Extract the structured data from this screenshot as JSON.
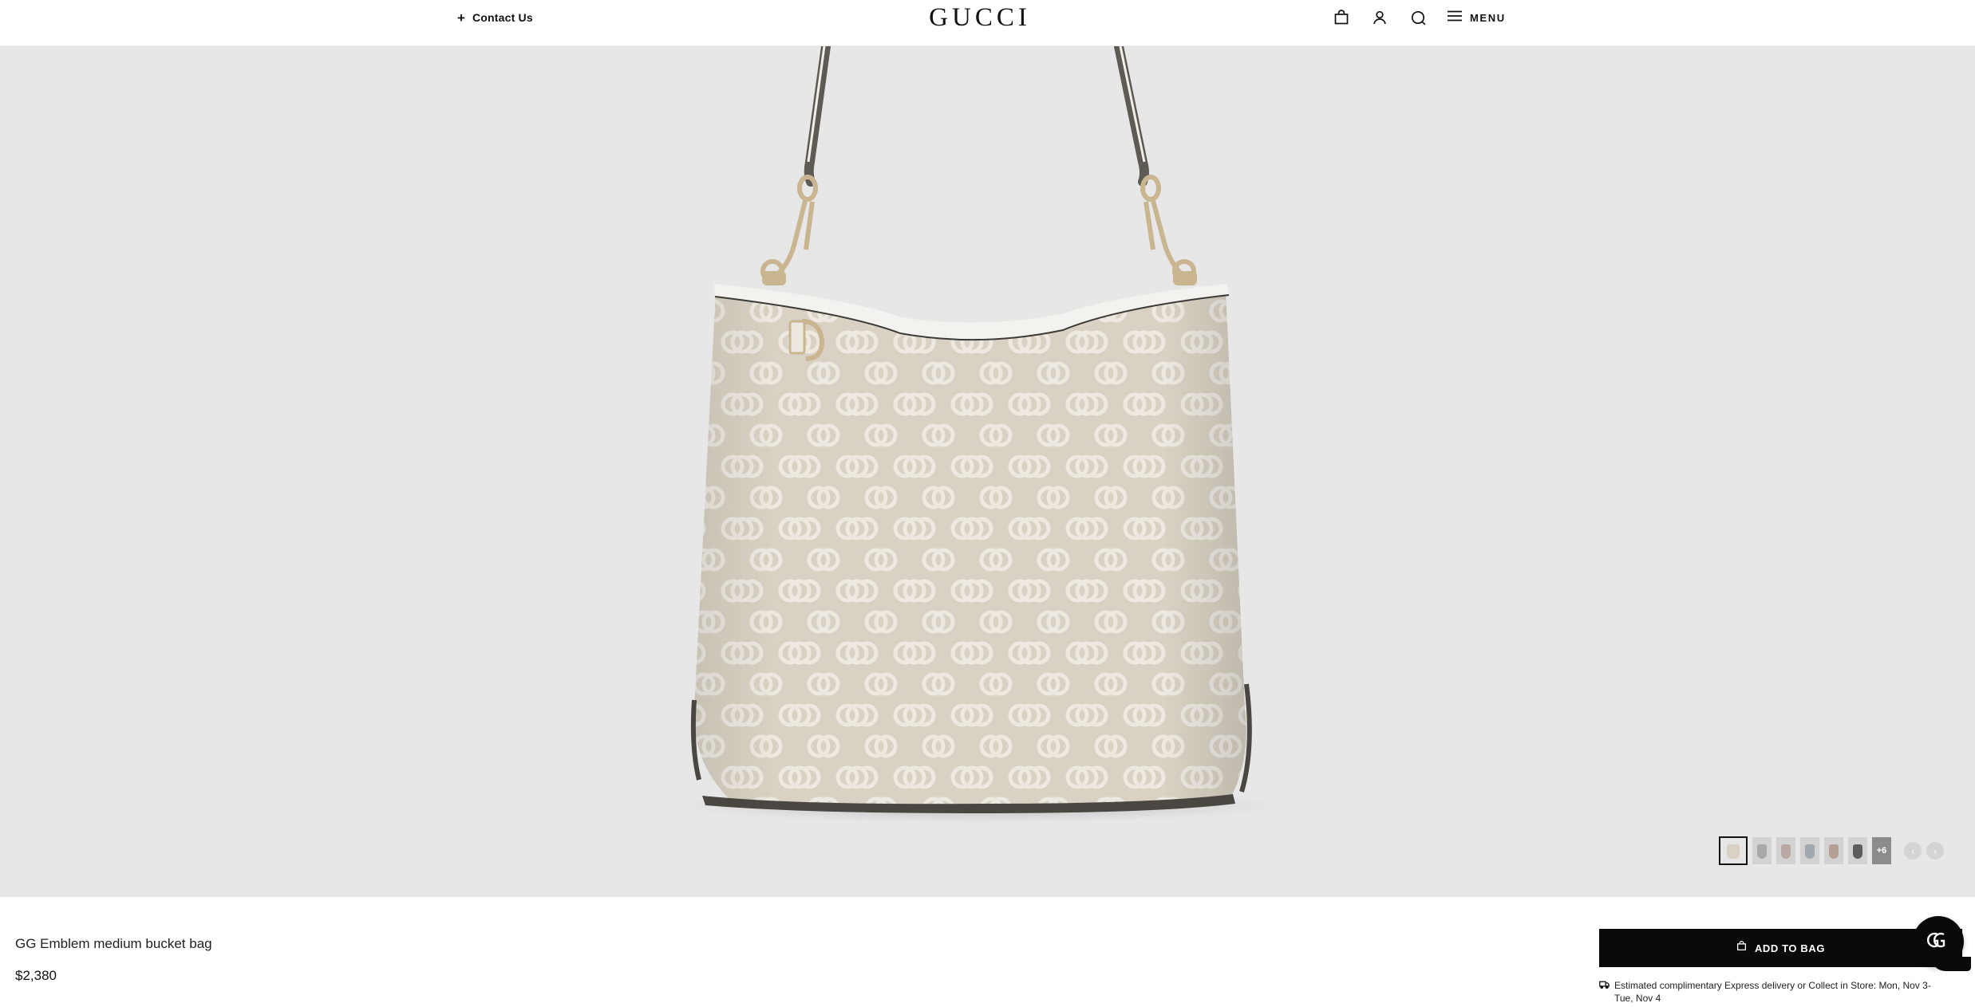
{
  "header": {
    "contact_plus": "+",
    "contact_label": "Contact Us",
    "logo": "GUCCI",
    "menu_label": "MENU",
    "icons": [
      "shopping-bag-icon",
      "account-icon",
      "search-icon",
      "hamburger-menu-icon"
    ]
  },
  "product": {
    "name": "GG Emblem medium bucket bag",
    "price": "$2,380",
    "add_to_bag": "ADD TO BAG",
    "delivery": "Estimated complimentary Express delivery or Collect in Store: Mon, Nov 3- Tue, Nov 4"
  },
  "gallery": {
    "thumbnail_count": 6,
    "more_label": "+6",
    "selected_index": 0,
    "prev_label": "‹",
    "next_label": "›"
  },
  "colors": {
    "accent": "#0a0a0a",
    "hero_background": "#e7e7e7",
    "canvas": "#d9d2c4",
    "monogram": "#ede9e1",
    "trim": "#f4f2ee",
    "hardware": "#c9b590"
  }
}
